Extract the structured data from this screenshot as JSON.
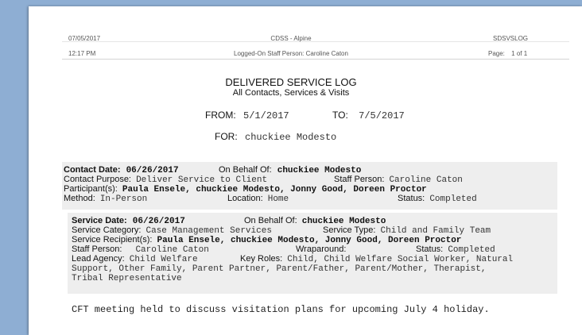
{
  "header": {
    "date": "07/05/2017",
    "time": "12:17 PM",
    "org": "CDSS - Alpine",
    "staff_line": "Logged-On Staff Person: Caroline Caton",
    "report_code": "SDSVSLOG",
    "page_label": "Page:",
    "page_value": "1 of 1"
  },
  "report": {
    "title": "DELIVERED SERVICE LOG",
    "subtitle": "All Contacts, Services & Visits",
    "from_label": "FROM:",
    "from_value": "5/1/2017",
    "to_label": "TO:",
    "to_value": "7/5/2017",
    "for_label": "FOR:",
    "for_value": "chuckiee Modesto"
  },
  "contact": {
    "date_label": "Contact Date:",
    "date_value": "06/26/2017",
    "behalf_label": "On Behalf Of:",
    "behalf_value": "chuckiee Modesto",
    "purpose_label": "Contact Purpose:",
    "purpose_value": "Deliver Service to Client",
    "staff_label": "Staff Person:",
    "staff_value": "Caroline Caton",
    "participants_label": "Participant(s):",
    "participants_value": "Paula Ensele, chuckiee Modesto, Jonny Good, Doreen Proctor",
    "method_label": "Method:",
    "method_value": "In-Person",
    "location_label": "Location:",
    "location_value": "Home",
    "status_label": "Status:",
    "status_value": "Completed"
  },
  "service": {
    "date_label": "Service Date:",
    "date_value": "06/26/2017",
    "behalf_label": "On Behalf Of:",
    "behalf_value": "chuckiee Modesto",
    "category_label": "Service Category:",
    "category_value": "Case Management Services",
    "type_label": "Service Type:",
    "type_value": "Child and Family Team",
    "recipients_label": "Service Recipient(s):",
    "recipients_value": "Paula Ensele, chuckiee Modesto, Jonny Good, Doreen Proctor",
    "staff_label": "Staff Person:",
    "staff_value": "Caroline Caton",
    "wrap_label": "Wraparound:",
    "status_label": "Status:",
    "status_value": "Completed",
    "agency_label": "Lead Agency:",
    "agency_value": "Child Welfare",
    "roles_label": "Key Roles:",
    "roles_line1": "Child, Child Welfare Social Worker, Natural",
    "roles_line2": "Support, Other Family, Parent Partner, Parent/Father, Parent/Mother, Therapist,",
    "roles_line3": "Tribal Representative"
  },
  "note": "CFT meeting held to discuss visitation plans for upcoming July 4 holiday."
}
